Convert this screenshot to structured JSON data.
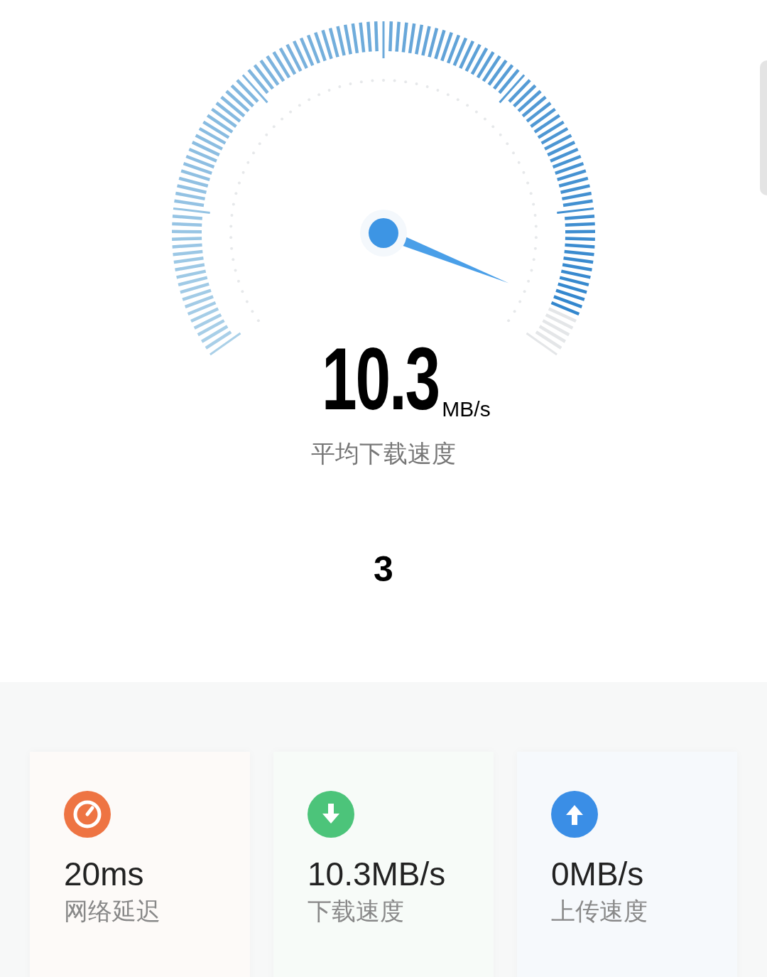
{
  "speed": {
    "value": "10.3",
    "unit": "MB/s",
    "label": "平均下载速度"
  },
  "countdown": "3",
  "stats": [
    {
      "kind": "latency",
      "color": "#ee7443",
      "value": "20ms",
      "label": "网络延迟"
    },
    {
      "kind": "download",
      "color": "#4cc47a",
      "value": "10.3MB/s",
      "label": "下载速度"
    },
    {
      "kind": "upload",
      "color": "#3a8ee6",
      "value": "0MB/s",
      "label": "上传速度"
    }
  ]
}
